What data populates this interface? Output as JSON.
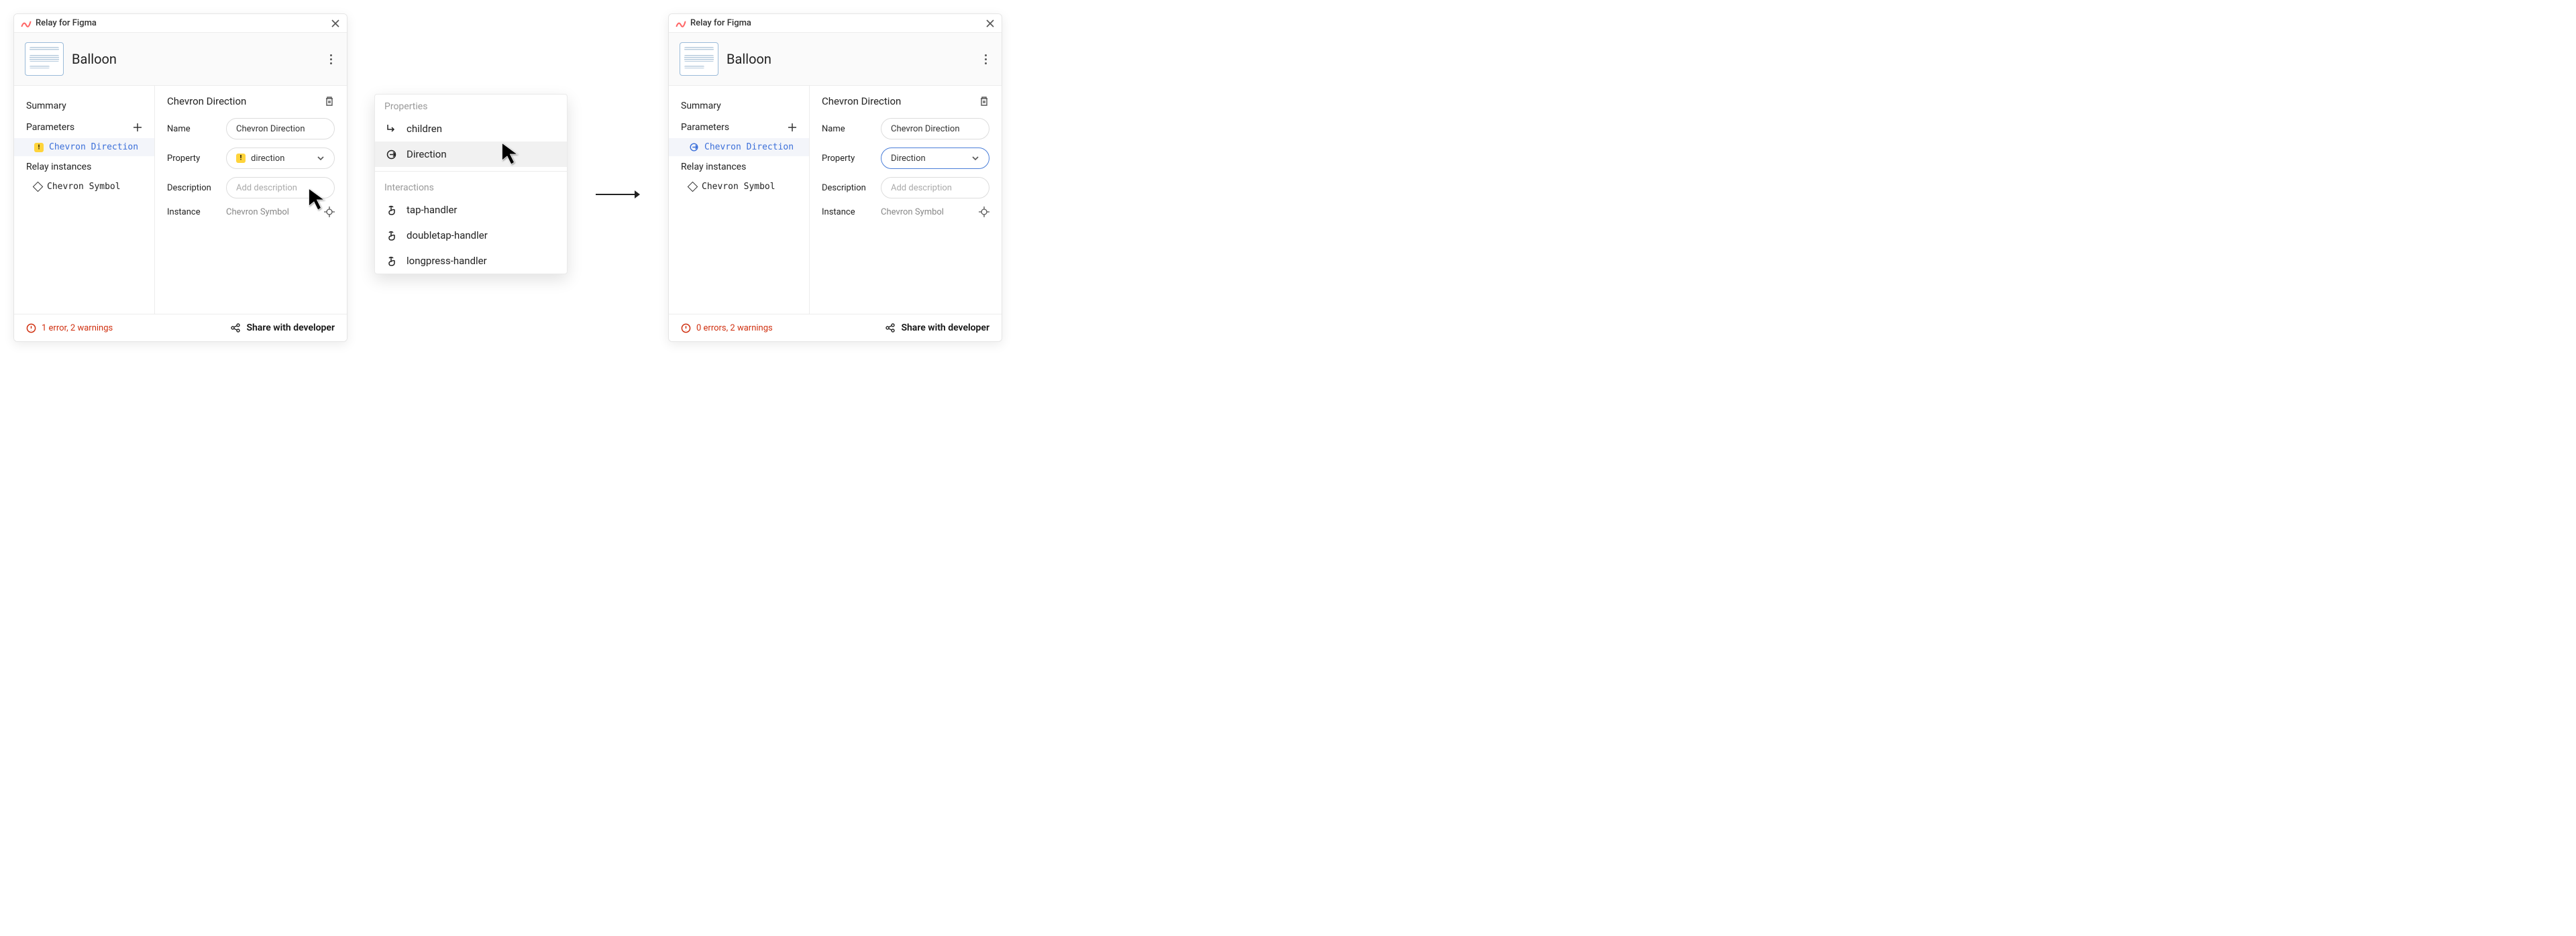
{
  "header_title": "Relay for Figma",
  "component_name": "Balloon",
  "sidebar": {
    "summary_label": "Summary",
    "parameters_label": "Parameters",
    "instances_label": "Relay instances",
    "param_item": "Chevron Direction",
    "instance_item": "Chevron Symbol"
  },
  "detail": {
    "title": "Chevron Direction",
    "name_label": "Name",
    "name_value": "Chevron Direction",
    "property_label": "Property",
    "property_value_before": "direction",
    "property_value_after": "Direction",
    "description_label": "Description",
    "description_placeholder": "Add description",
    "instance_label": "Instance",
    "instance_value": "Chevron Symbol"
  },
  "footer": {
    "status_before": "1 error, 2 warnings",
    "status_after": "0 errors, 2 warnings",
    "share_label": "Share with developer"
  },
  "popover": {
    "section_properties": "Properties",
    "section_interactions": "Interactions",
    "items_properties": [
      "children",
      "Direction"
    ],
    "items_interactions": [
      "tap-handler",
      "doubletap-handler",
      "longpress-handler"
    ]
  }
}
